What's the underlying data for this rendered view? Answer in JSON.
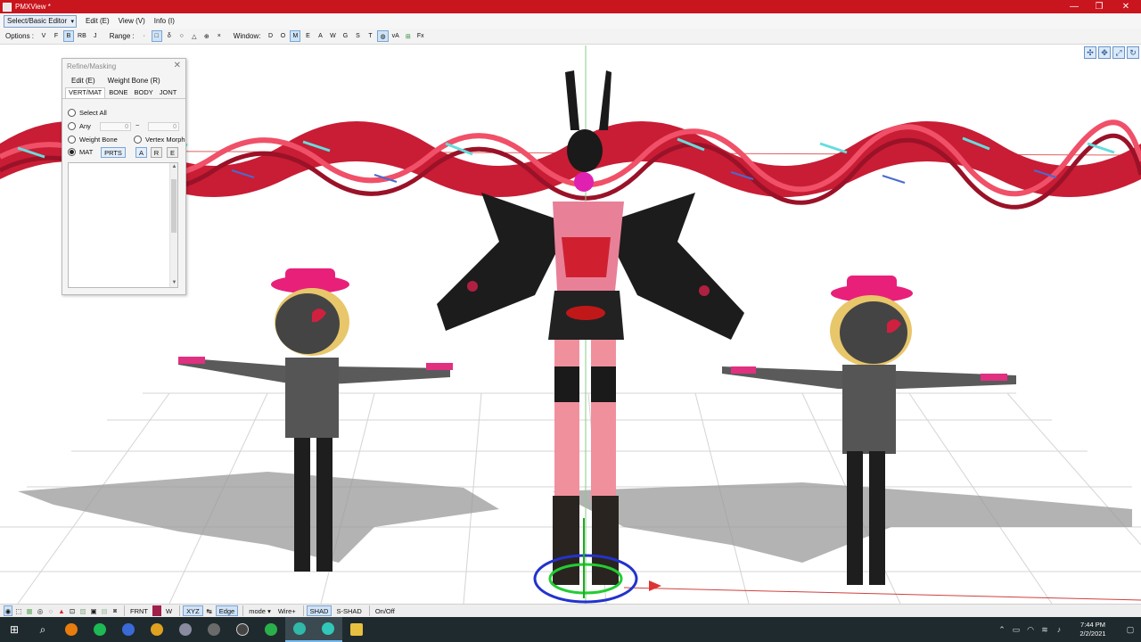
{
  "window": {
    "title": "PMXView *",
    "controls": [
      "—",
      "❐",
      "✕"
    ]
  },
  "menubar": {
    "mode_combo": "Select/Basic Editor",
    "items": [
      "Edit (E)",
      "View (V)",
      "Info (I)"
    ]
  },
  "options_bar": {
    "options_label": "Options :",
    "options": [
      "V",
      "F",
      "B",
      "RB",
      "J"
    ],
    "range_label": "Range :",
    "range_tools": [
      "·",
      "□",
      "δ",
      "○",
      "△",
      "⊕",
      "×"
    ],
    "window_label": "Window:",
    "window_tools": [
      "D",
      "O",
      "M",
      "E",
      "A",
      "W",
      "G",
      "S",
      "T"
    ],
    "extra": [
      "vA",
      "Fx"
    ]
  },
  "panel": {
    "title": "Refine/Masking",
    "menu": [
      "Edit (E)",
      "Weight Bone (R)"
    ],
    "tabs": [
      "VERT/MAT",
      "BONE",
      "BODY",
      "JONT"
    ],
    "select_all": "Select All",
    "any": "Any",
    "any_from": "0",
    "tilde": "~",
    "any_to": "0",
    "weight_bone": "Weight Bone",
    "vertex_morph": "Vertex Morph",
    "mat": "MAT",
    "prts": "PRTS",
    "btn_a": "A",
    "btn_r": "R",
    "btn_e": "E"
  },
  "bottom_bar": {
    "frnt": "FRNT",
    "w": "W",
    "xyz": "XYZ",
    "edge": "Edge",
    "mode": "mode",
    "wire": "Wire+",
    "shad": "SHAD",
    "sshad": "S-SHAD",
    "onoff": "On/Off"
  },
  "taskbar": {
    "time": "7:44 PM",
    "date": "2/2/2021"
  }
}
